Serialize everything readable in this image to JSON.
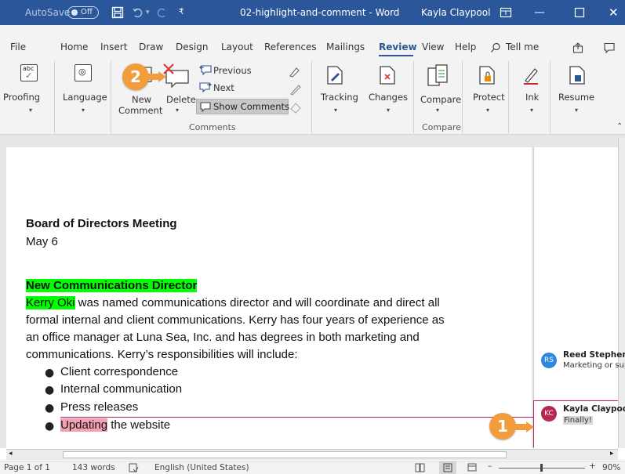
{
  "titlebar": {
    "autosave_label": "AutoSave",
    "autosave_state": "Off",
    "doc_title": "02-highlight-and-comment - Word",
    "user_name": "Kayla Claypool",
    "bg": "#2b579a"
  },
  "tabs": [
    "File",
    "Home",
    "Insert",
    "Draw",
    "Design",
    "Layout",
    "References",
    "Mailings",
    "Review",
    "View",
    "Help"
  ],
  "active_tab": "Review",
  "tell_me": "Tell me",
  "ribbon": {
    "proofing": "Proofing",
    "language": "Language",
    "new_comment_1": "New",
    "new_comment_2": "Comment",
    "delete": "Delete",
    "previous": "Previous",
    "next": "Next",
    "show_comments": "Show Comments",
    "comments_group": "Comments",
    "tracking": "Tracking",
    "changes": "Changes",
    "compare": "Compare",
    "compare_group": "Compare",
    "protect": "Protect",
    "ink": "Ink",
    "resume": "Resume",
    "abc": "abc"
  },
  "document": {
    "heading": "Board of Directors Meeting",
    "date": "May 6",
    "section_title": "New Communications Director",
    "para_start": "Kerry Oki",
    "para_line1_rest": " was named communications director and will coordinate and direct all",
    "para_line2": "formal internal and client communications. Kerry has four years of experience as",
    "para_line3": "an office manager at Luna Sea, Inc. and has degrees in both marketing and",
    "para_line4": "communications. Kerry’s responsibilities will include:",
    "bullets": [
      "Client correspondence",
      "Internal communication",
      "Press releases"
    ],
    "last_bullet_highlight": "Updating",
    "last_bullet_rest": " the website"
  },
  "comments": [
    {
      "initials": "RS",
      "author": "Reed Stephens",
      "text": "Marketing or sup",
      "color": "#2e86de"
    },
    {
      "initials": "KC",
      "author": "Kayla Claypool",
      "text": "Finally!",
      "color": "#b9264f"
    }
  ],
  "callouts": [
    "1",
    "2"
  ],
  "statusbar": {
    "page": "Page 1 of 1",
    "words": "143 words",
    "language": "English (United States)",
    "zoom": "90%"
  }
}
